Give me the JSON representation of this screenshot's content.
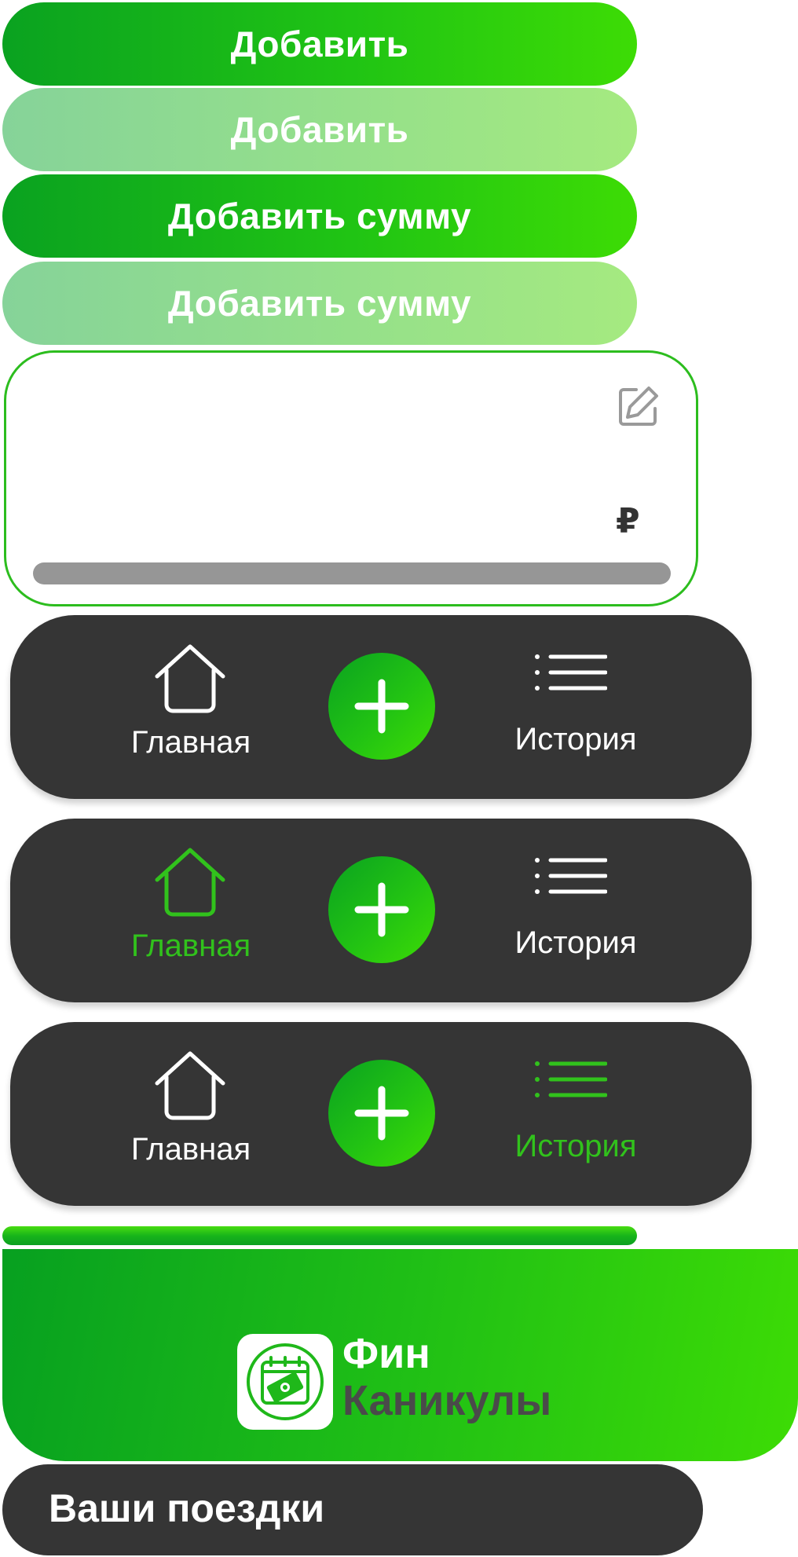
{
  "buttons": [
    {
      "label": "Добавить",
      "state": "active"
    },
    {
      "label": "Добавить",
      "state": "disabled"
    },
    {
      "label": "Добавить сумму",
      "state": "active"
    },
    {
      "label": "Добавить сумму",
      "state": "disabled"
    }
  ],
  "amount_card": {
    "edit_icon": "edit-pencil-icon",
    "value": "",
    "currency": "₽",
    "progress": 1.0
  },
  "navbars": [
    {
      "home_label": "Главная",
      "history_label": "История",
      "active": "none"
    },
    {
      "home_label": "Главная",
      "history_label": "История",
      "active": "home"
    },
    {
      "home_label": "Главная",
      "history_label": "История",
      "active": "history"
    }
  ],
  "brand": {
    "line1": "Фин",
    "line2": "Каникулы",
    "logo_icon": "calendar-money-icon"
  },
  "trips": {
    "title": "Ваши поездки"
  },
  "colors": {
    "accent_green": "#22c313",
    "accent_green_dark": "#0aa220",
    "accent_green_light": "#3ddc05",
    "disabled_green": "#95e08a",
    "dark_surface": "#353535",
    "track_gray": "#969696",
    "active_nav_text": "#31c21c"
  }
}
